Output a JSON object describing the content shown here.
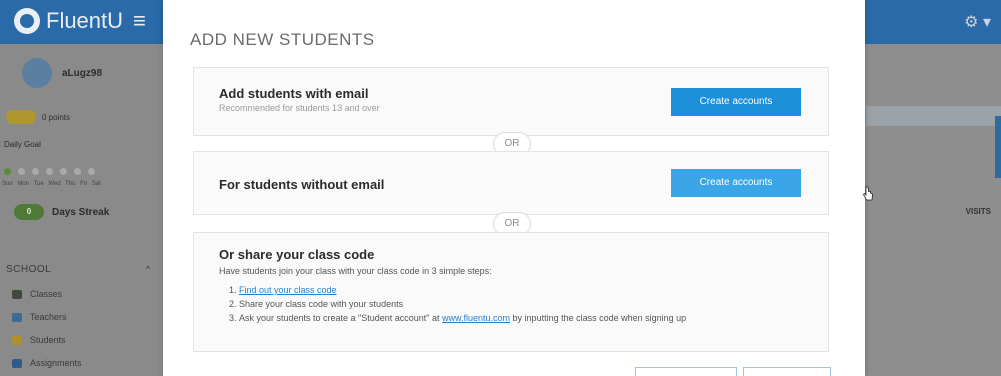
{
  "app": {
    "brand": "FluentU",
    "username": "aLugz98",
    "points": "0 points",
    "daily_goal": "Daily Goal",
    "days": "Sun Mon Tue Wed Thu Fri Sat",
    "streak_count": "0",
    "streak_label": "Days Streak",
    "school_section": "SCHOOL",
    "nav": [
      {
        "label": "Classes",
        "icon": "classes-icon",
        "color": "#3f4a3a"
      },
      {
        "label": "Teachers",
        "icon": "teachers-icon",
        "color": "#3c6a93"
      },
      {
        "label": "Students",
        "icon": "students-icon",
        "color": "#b0902a"
      },
      {
        "label": "Assignments",
        "icon": "assignments-icon",
        "color": "#2f5b8a"
      }
    ],
    "right_header": "VISITS"
  },
  "modal": {
    "title": "ADD NEW STUDENTS",
    "email_card": {
      "heading": "Add students with email",
      "subtext": "Recommended for students 13 and over",
      "button": "Create accounts"
    },
    "or_label": "OR",
    "no_email_card": {
      "heading": "For students without email",
      "button": "Create accounts"
    },
    "share_card": {
      "heading": "Or share your class code",
      "description": "Have students join your class with your class code in 3 simple steps:",
      "steps": [
        {
          "num": "1.",
          "link": "Find out your class code"
        },
        {
          "num": "2.",
          "text": "Share your class code with your students"
        },
        {
          "num": "3.",
          "before": "Ask your students to create a \"Student account\" at ",
          "link": "www.fluentu.com",
          "after": " by inputting the class code when signing up"
        }
      ]
    }
  },
  "colors": {
    "primary_button": "#1e8fd9",
    "link": "#2a7ec9",
    "brand_bar": "#2a6aa8"
  }
}
